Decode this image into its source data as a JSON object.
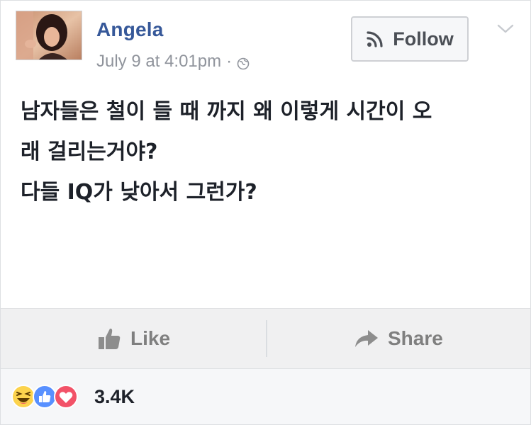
{
  "post": {
    "author": "Angela",
    "timestamp": "July 9 at 4:01pm",
    "separator": "·",
    "privacy_icon": "globe-icon",
    "follow_label": "Follow",
    "menu_icon": "chevron-down-icon",
    "text_lines": [
      "남자들은 철이 들 때 까지 왜 이렇게 시간이 오",
      "래 걸리는거야?",
      "다들 IQ가 낮아서 그런가?"
    ]
  },
  "actions": {
    "like_label": "Like",
    "like_icon": "thumbs-up-icon",
    "share_label": "Share",
    "share_icon": "share-arrow-icon"
  },
  "reactions": {
    "icons": [
      "haha-reaction-icon",
      "like-reaction-icon",
      "love-reaction-icon"
    ],
    "count": "3.4K"
  },
  "colors": {
    "author_blue": "#365899",
    "meta_gray": "#90949c",
    "action_gray": "#7f7f7f",
    "like_blue": "#5890ff",
    "love_red": "#f25268",
    "haha_yellow": "#fcd34d"
  }
}
